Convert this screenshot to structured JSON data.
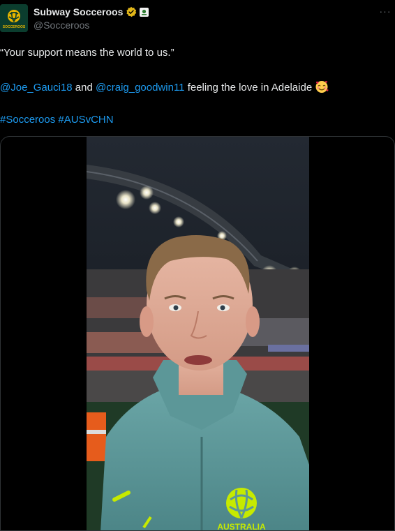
{
  "author": {
    "display_name": "Subway Socceroos",
    "handle": "@Socceroos",
    "avatar_icon": "socceroos-logo",
    "avatar_text": "SOCCEROOS"
  },
  "tweet": {
    "quote_line": "“Your support means the world to us.”",
    "mention_1": "@Joe_Gauci18",
    "and_text": " and ",
    "mention_2": "@craig_goodwin11",
    "love_text": " feeling the love in Adelaide ",
    "emoji": "smiling-face-with-hearts",
    "hashtag_1": "#Socceroos",
    "hashtag_2": "#AUSvCHN",
    "jersey_text": "AUSTRALIA"
  },
  "colors": {
    "link": "#1d9bf0",
    "text": "#e7e9ea",
    "muted": "#71767b",
    "verified_gold": "#e2b719",
    "jersey_teal": "#5e9a9a",
    "jersey_yellow": "#b7e000"
  },
  "more_icon": "ellipsis-icon"
}
